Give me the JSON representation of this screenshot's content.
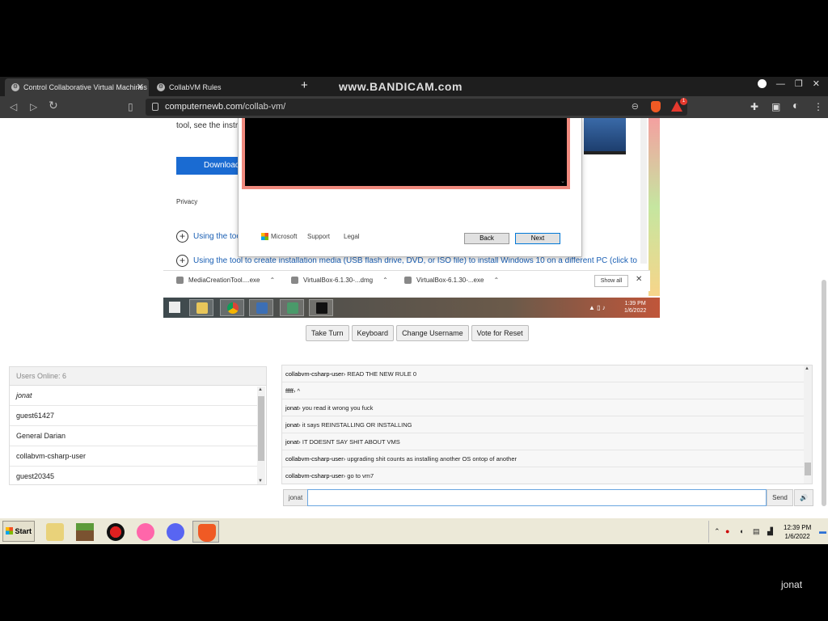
{
  "browser": {
    "tabs": [
      {
        "title": "Control Collaborative Virtual Machines"
      },
      {
        "title": "CollabVM Rules"
      }
    ],
    "new_tab": "+",
    "watermark": "www.BANDICAM.com",
    "url_host": "computernewb.com",
    "url_path": "/collab-vm/",
    "brave_count": "1"
  },
  "vm_screen": {
    "bg_text": "tool, see the instru",
    "download_label": "Download",
    "privacy_label": "Privacy",
    "expander1": "Using the too",
    "expander2": "Using the tool to create installation media (USB flash drive, DVD, or ISO file) to install Windows 10 on a different PC (click to",
    "dialog": {
      "brand": "Microsoft",
      "support": "Support",
      "legal": "Legal",
      "back": "Back",
      "next": "Next"
    },
    "downloads": [
      {
        "name": "MediaCreationTool....exe"
      },
      {
        "name": "VirtualBox-6.1.30-...dmg"
      },
      {
        "name": "VirtualBox-6.1.30-...exe"
      }
    ],
    "show_all": "Show all",
    "clock_time": "1:39 PM",
    "clock_date": "1/6/2022"
  },
  "vm_controls": {
    "take_turn": "Take Turn",
    "keyboard": "Keyboard",
    "change_username": "Change Username",
    "vote_reset": "Vote for Reset"
  },
  "users": {
    "header": "Users Online: 6",
    "list": [
      "jonat",
      "guest61427",
      "General Darian",
      "collabvm-csharp-user",
      "guest20345"
    ]
  },
  "chat": {
    "messages": [
      {
        "user": "collabvm-csharp-user",
        "text": "READ THE NEW RULE 0"
      },
      {
        "user": "fffff",
        "text": "^"
      },
      {
        "user": "jonat",
        "text": "you read it wrong you fuck"
      },
      {
        "user": "jonat",
        "text": "it says REINSTALLING OR INSTALLING"
      },
      {
        "user": "jonat",
        "text": "IT DOESNT SAY SHIT ABOUT VMS"
      },
      {
        "user": "collabvm-csharp-user",
        "text": "upgrading shit counts as installing another OS ontop of another"
      },
      {
        "user": "collabvm-csharp-user",
        "text": "go to vm7"
      }
    ],
    "input_name": "jonat",
    "input_value": "",
    "send_label": "Send",
    "volume_label": "🔊"
  },
  "host_taskbar": {
    "start_label": "Start",
    "clock_time": "12:39 PM",
    "clock_date": "1/6/2022"
  },
  "footer_username": "jonat"
}
